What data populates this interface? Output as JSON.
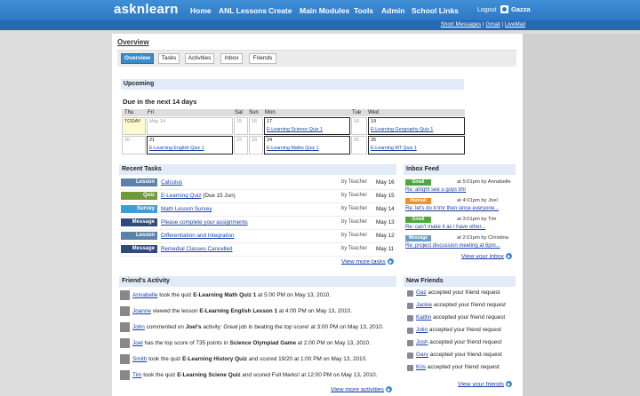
{
  "app": {
    "logo": "asknlearn"
  },
  "nav": {
    "items": [
      "Home",
      "ANL Lessons",
      "Create",
      "Main Modules",
      "Tools",
      "Admin",
      "School Links"
    ],
    "logout": "Logout",
    "user": "Gazza"
  },
  "quicklinks": {
    "short_messages": "Short Messages",
    "sep1": " | ",
    "gmail": "Gmail",
    "sep2": " | ",
    "livemail": "LiveMail"
  },
  "page": {
    "title": "Overview"
  },
  "tabs": [
    "Overview",
    "Tasks",
    "Activities",
    "Inbox",
    "Friends"
  ],
  "upcoming": {
    "header": "Upcoming",
    "subtitle": "Due in the next 14 days",
    "days": [
      "Thu",
      "Fri",
      "Sat",
      "Sun",
      "Mon",
      "Tue",
      "Wed"
    ],
    "week1": [
      {
        "num": "TODAY",
        "event": ""
      },
      {
        "num": "May 14",
        "event": ""
      },
      {
        "num": "15",
        "event": ""
      },
      {
        "num": "16",
        "event": ""
      },
      {
        "num": "17",
        "event": "E-Learning Science Quiz 1"
      },
      {
        "num": "18",
        "event": ""
      },
      {
        "num": "19",
        "event": "E-Learning Geography Quiz 1"
      }
    ],
    "week2": [
      {
        "num": "20",
        "event": ""
      },
      {
        "num": "21",
        "event": "E-Learning English Quiz 1"
      },
      {
        "num": "22",
        "event": ""
      },
      {
        "num": "23",
        "event": ""
      },
      {
        "num": "24",
        "event": "E-Learning Maths Quiz 1"
      },
      {
        "num": "25",
        "event": ""
      },
      {
        "num": "26",
        "event": "E-Learning MT Quiz 1"
      }
    ]
  },
  "recent_tasks": {
    "header": "Recent Tasks",
    "rows": [
      {
        "type": "Lesson",
        "color": "#5b82a8",
        "name": "Calculus",
        "suffix": "",
        "by": "by Teacher",
        "date": "May 16"
      },
      {
        "type": "Quiz",
        "color": "#6e9a3c",
        "name": "E-Learning Quiz",
        "suffix": " (Due 15 Jun)",
        "by": "by Teacher",
        "date": "May 15"
      },
      {
        "type": "Survey",
        "color": "#3d9ed6",
        "name": "Math Lesson Survey",
        "suffix": "",
        "by": "by Teacher",
        "date": "May 14"
      },
      {
        "type": "Message",
        "color": "#2f4a7a",
        "name": "Please complete your assignments",
        "suffix": "",
        "by": "by Teacher",
        "date": "May 13"
      },
      {
        "type": "Lesson",
        "color": "#5b82a8",
        "name": "Differentiation and Integration",
        "suffix": "",
        "by": "by Teacher",
        "date": "May 12"
      },
      {
        "type": "Message",
        "color": "#2f4a7a",
        "name": "Remedial Classes Cancelled",
        "suffix": "",
        "by": "by Teacher",
        "date": "May 11"
      }
    ],
    "more": "View more tasks"
  },
  "inbox": {
    "header": "Inbox Feed",
    "items": [
      {
        "type": "Gmail",
        "color": "#4fa83d",
        "meta": "at 5:01pm by Annabelle",
        "subject": "Re: alright see u guys tmr"
      },
      {
        "type": "Hotmail",
        "color": "#e8942a",
        "meta": "at 4:01pm by Joel",
        "subject": "Re: let's do it tmr then since everyone..."
      },
      {
        "type": "Gmail",
        "color": "#4fa83d",
        "meta": "at 3:01pm by Tim",
        "subject": "Re: can't make it as i have other..."
      },
      {
        "type": "Message",
        "color": "#6a9cc8",
        "meta": "at 2:01pm by Christina",
        "subject": "Re: project discussion meeting at 6pm..."
      }
    ],
    "more": "View your inbox"
  },
  "activity": {
    "header": "Friend's Activity",
    "rows": [
      {
        "user": "Annabelle",
        "pre": " took the quiz ",
        "bold": "E-Learning Math Quiz 1",
        "post": " at 5:00 PM on May 13, 2010."
      },
      {
        "user": "Joanne",
        "pre": " viewed the lesson ",
        "bold": "E-Learning English Lesson 1",
        "post": " at 4:00 PM on May 13, 2010."
      },
      {
        "user": "John",
        "pre": " commented on ",
        "bold": "Joel's",
        "post": " activity: Great job in beating the top score! at 3:00 PM on May 13, 2010."
      },
      {
        "user": "Joel",
        "pre": " has the top score of 735 points in ",
        "bold": "Science Olympiad Game",
        "post": " at 2:00 PM on May 13, 2010."
      },
      {
        "user": "Smith",
        "pre": " took the quiz ",
        "bold": "E-Learning History Quiz",
        "post": " and scored 19/20 at 1:00 PM on May 13, 2010."
      },
      {
        "user": "Tim",
        "pre": " took the quiz ",
        "bold": "E-Learning Sciene Quiz",
        "post": " and scored Full Marks! at 12:00 PM on May 13, 2010."
      }
    ],
    "more": "View more activities"
  },
  "friends": {
    "header": "New Friends",
    "rows": [
      {
        "name": "Gaz",
        "text": " accepted your friend request"
      },
      {
        "name": "Jackie",
        "text": " accepted your friend request"
      },
      {
        "name": "Kaitlin",
        "text": " accepted your friend request"
      },
      {
        "name": "Jolin",
        "text": " accepted your friend request"
      },
      {
        "name": "Josh",
        "text": " accepted your friend request"
      },
      {
        "name": "Gary",
        "text": " accepted your friend request"
      },
      {
        "name": "Kris",
        "text": " accepted your friend request"
      }
    ],
    "more": "View your friends"
  }
}
